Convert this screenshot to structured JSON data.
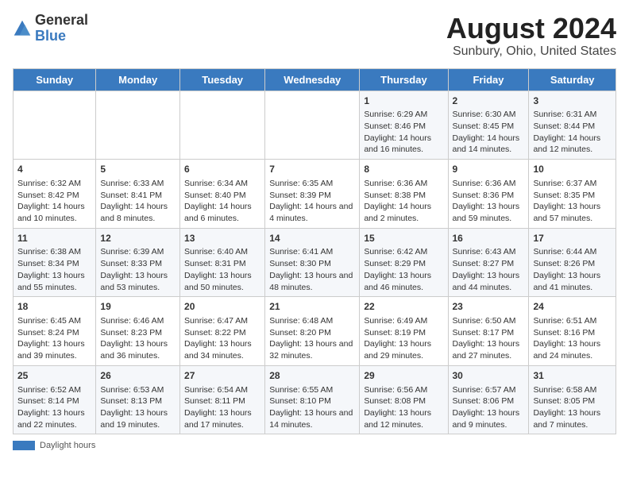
{
  "header": {
    "logo_general": "General",
    "logo_blue": "Blue",
    "main_title": "August 2024",
    "subtitle": "Sunbury, Ohio, United States"
  },
  "calendar": {
    "days_of_week": [
      "Sunday",
      "Monday",
      "Tuesday",
      "Wednesday",
      "Thursday",
      "Friday",
      "Saturday"
    ],
    "weeks": [
      [
        {
          "day": "",
          "content": ""
        },
        {
          "day": "",
          "content": ""
        },
        {
          "day": "",
          "content": ""
        },
        {
          "day": "",
          "content": ""
        },
        {
          "day": "1",
          "content": "Sunrise: 6:29 AM\nSunset: 8:46 PM\nDaylight: 14 hours and 16 minutes."
        },
        {
          "day": "2",
          "content": "Sunrise: 6:30 AM\nSunset: 8:45 PM\nDaylight: 14 hours and 14 minutes."
        },
        {
          "day": "3",
          "content": "Sunrise: 6:31 AM\nSunset: 8:44 PM\nDaylight: 14 hours and 12 minutes."
        }
      ],
      [
        {
          "day": "4",
          "content": "Sunrise: 6:32 AM\nSunset: 8:42 PM\nDaylight: 14 hours and 10 minutes."
        },
        {
          "day": "5",
          "content": "Sunrise: 6:33 AM\nSunset: 8:41 PM\nDaylight: 14 hours and 8 minutes."
        },
        {
          "day": "6",
          "content": "Sunrise: 6:34 AM\nSunset: 8:40 PM\nDaylight: 14 hours and 6 minutes."
        },
        {
          "day": "7",
          "content": "Sunrise: 6:35 AM\nSunset: 8:39 PM\nDaylight: 14 hours and 4 minutes."
        },
        {
          "day": "8",
          "content": "Sunrise: 6:36 AM\nSunset: 8:38 PM\nDaylight: 14 hours and 2 minutes."
        },
        {
          "day": "9",
          "content": "Sunrise: 6:36 AM\nSunset: 8:36 PM\nDaylight: 13 hours and 59 minutes."
        },
        {
          "day": "10",
          "content": "Sunrise: 6:37 AM\nSunset: 8:35 PM\nDaylight: 13 hours and 57 minutes."
        }
      ],
      [
        {
          "day": "11",
          "content": "Sunrise: 6:38 AM\nSunset: 8:34 PM\nDaylight: 13 hours and 55 minutes."
        },
        {
          "day": "12",
          "content": "Sunrise: 6:39 AM\nSunset: 8:33 PM\nDaylight: 13 hours and 53 minutes."
        },
        {
          "day": "13",
          "content": "Sunrise: 6:40 AM\nSunset: 8:31 PM\nDaylight: 13 hours and 50 minutes."
        },
        {
          "day": "14",
          "content": "Sunrise: 6:41 AM\nSunset: 8:30 PM\nDaylight: 13 hours and 48 minutes."
        },
        {
          "day": "15",
          "content": "Sunrise: 6:42 AM\nSunset: 8:29 PM\nDaylight: 13 hours and 46 minutes."
        },
        {
          "day": "16",
          "content": "Sunrise: 6:43 AM\nSunset: 8:27 PM\nDaylight: 13 hours and 44 minutes."
        },
        {
          "day": "17",
          "content": "Sunrise: 6:44 AM\nSunset: 8:26 PM\nDaylight: 13 hours and 41 minutes."
        }
      ],
      [
        {
          "day": "18",
          "content": "Sunrise: 6:45 AM\nSunset: 8:24 PM\nDaylight: 13 hours and 39 minutes."
        },
        {
          "day": "19",
          "content": "Sunrise: 6:46 AM\nSunset: 8:23 PM\nDaylight: 13 hours and 36 minutes."
        },
        {
          "day": "20",
          "content": "Sunrise: 6:47 AM\nSunset: 8:22 PM\nDaylight: 13 hours and 34 minutes."
        },
        {
          "day": "21",
          "content": "Sunrise: 6:48 AM\nSunset: 8:20 PM\nDaylight: 13 hours and 32 minutes."
        },
        {
          "day": "22",
          "content": "Sunrise: 6:49 AM\nSunset: 8:19 PM\nDaylight: 13 hours and 29 minutes."
        },
        {
          "day": "23",
          "content": "Sunrise: 6:50 AM\nSunset: 8:17 PM\nDaylight: 13 hours and 27 minutes."
        },
        {
          "day": "24",
          "content": "Sunrise: 6:51 AM\nSunset: 8:16 PM\nDaylight: 13 hours and 24 minutes."
        }
      ],
      [
        {
          "day": "25",
          "content": "Sunrise: 6:52 AM\nSunset: 8:14 PM\nDaylight: 13 hours and 22 minutes."
        },
        {
          "day": "26",
          "content": "Sunrise: 6:53 AM\nSunset: 8:13 PM\nDaylight: 13 hours and 19 minutes."
        },
        {
          "day": "27",
          "content": "Sunrise: 6:54 AM\nSunset: 8:11 PM\nDaylight: 13 hours and 17 minutes."
        },
        {
          "day": "28",
          "content": "Sunrise: 6:55 AM\nSunset: 8:10 PM\nDaylight: 13 hours and 14 minutes."
        },
        {
          "day": "29",
          "content": "Sunrise: 6:56 AM\nSunset: 8:08 PM\nDaylight: 13 hours and 12 minutes."
        },
        {
          "day": "30",
          "content": "Sunrise: 6:57 AM\nSunset: 8:06 PM\nDaylight: 13 hours and 9 minutes."
        },
        {
          "day": "31",
          "content": "Sunrise: 6:58 AM\nSunset: 8:05 PM\nDaylight: 13 hours and 7 minutes."
        }
      ]
    ]
  },
  "footer": {
    "daylight_label": "Daylight hours"
  }
}
